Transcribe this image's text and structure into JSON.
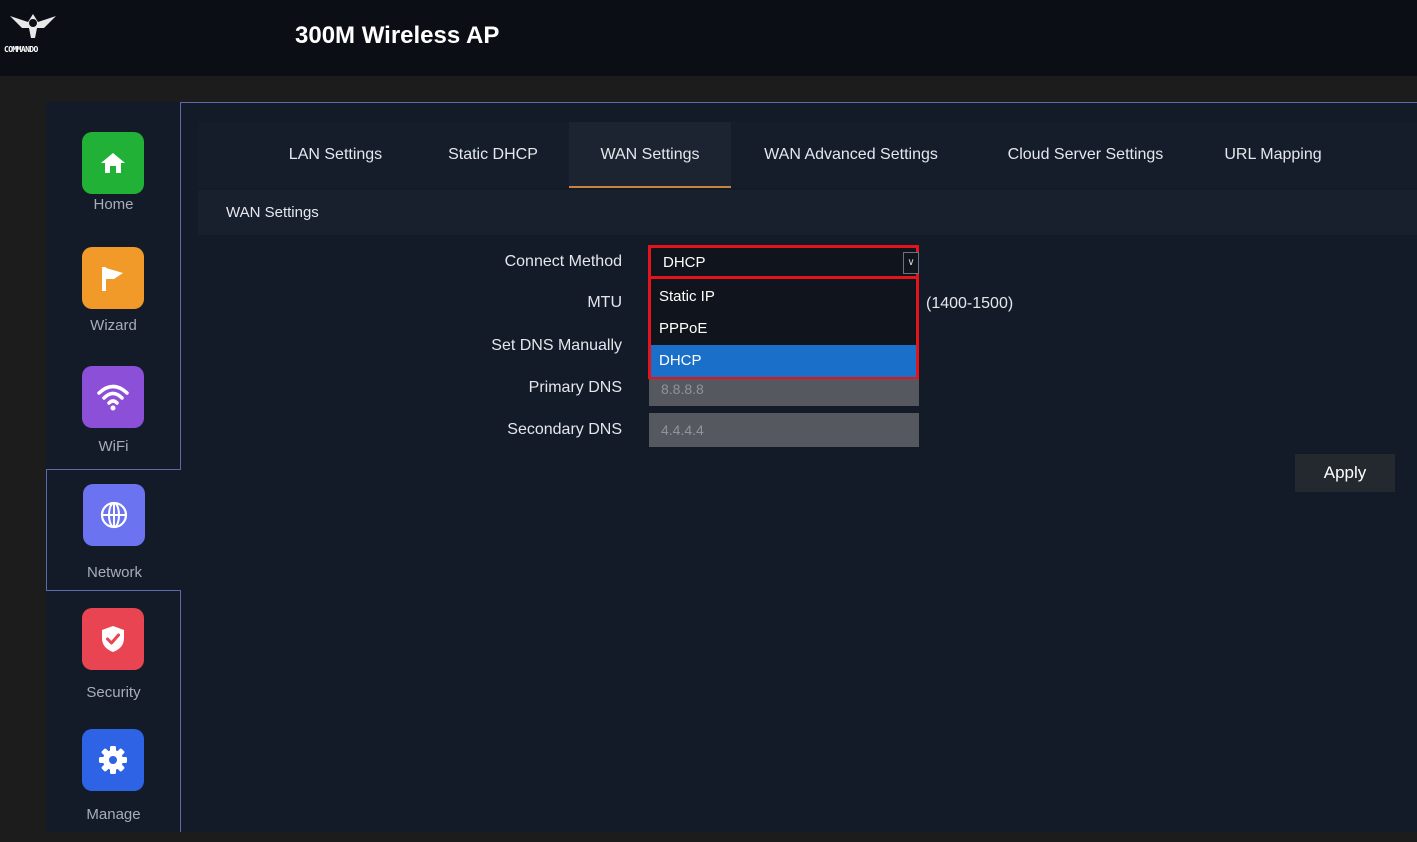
{
  "header": {
    "logo_text": "COMMANDO",
    "title": "300M Wireless AP"
  },
  "sidebar": {
    "items": [
      {
        "label": "Home",
        "icon": "home-icon",
        "color": "#21b136"
      },
      {
        "label": "Wizard",
        "icon": "flag-icon",
        "color": "#f19a2a"
      },
      {
        "label": "WiFi",
        "icon": "wifi-icon",
        "color": "#8c50d8"
      },
      {
        "label": "Network",
        "icon": "globe-icon",
        "color": "#6b73f1",
        "active": true
      },
      {
        "label": "Security",
        "icon": "shield-check-icon",
        "color": "#e94451"
      },
      {
        "label": "Manage",
        "icon": "gear-icon",
        "color": "#2f63e5"
      }
    ]
  },
  "tabs": [
    {
      "label": "LAN Settings"
    },
    {
      "label": "Static DHCP"
    },
    {
      "label": "WAN Settings",
      "active": true
    },
    {
      "label": "WAN Advanced Settings"
    },
    {
      "label": "Cloud Server Settings"
    },
    {
      "label": "URL Mapping"
    }
  ],
  "section": {
    "title": "WAN Settings"
  },
  "form": {
    "connect_method": {
      "label": "Connect Method",
      "value": "DHCP",
      "options": [
        "Static IP",
        "PPPoE",
        "DHCP"
      ],
      "selected_option": "DHCP"
    },
    "mtu": {
      "label": "MTU",
      "hint": "(1400-1500)"
    },
    "set_dns_manually": {
      "label": "Set DNS Manually"
    },
    "primary_dns": {
      "label": "Primary DNS",
      "value": "8.8.8.8"
    },
    "secondary_dns": {
      "label": "Secondary DNS",
      "value": "4.4.4.4"
    },
    "apply_label": "Apply"
  },
  "colors": {
    "highlight_border": "#e3141b",
    "selected_option": "#1a6fc9",
    "active_tab_underline": "#c8843a"
  }
}
